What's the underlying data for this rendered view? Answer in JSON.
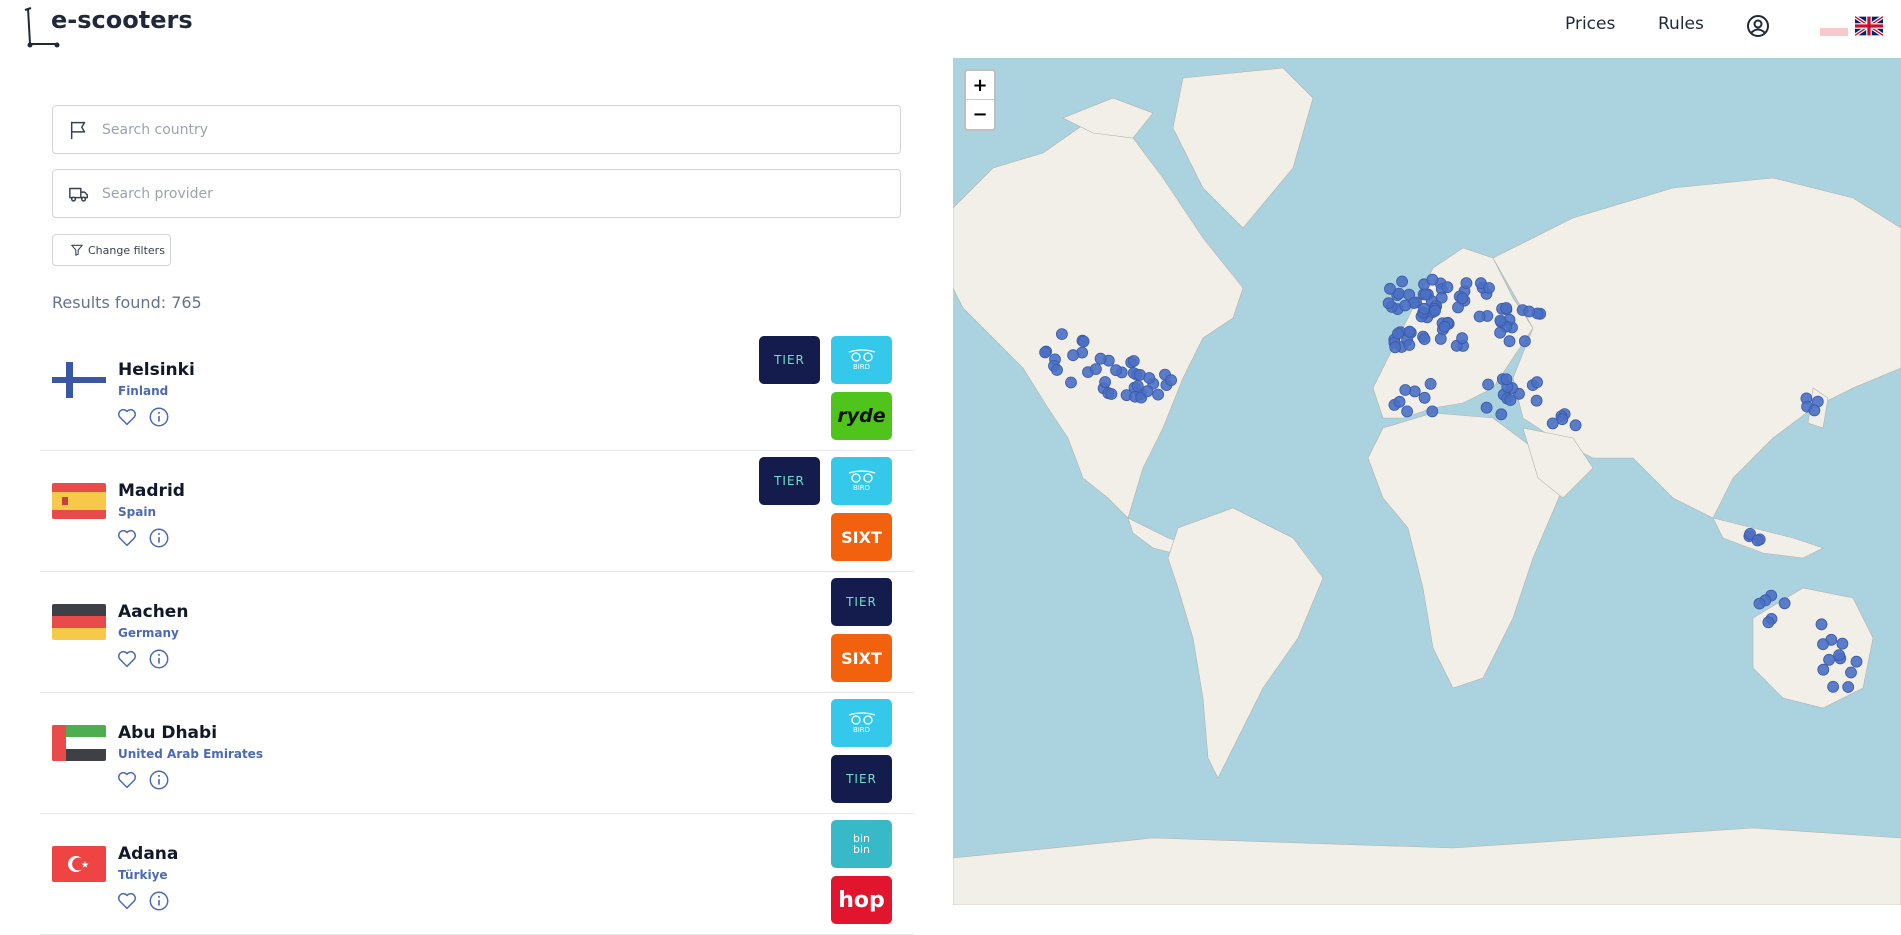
{
  "header": {
    "logo_text": "e-scooters",
    "nav": {
      "prices": "Prices",
      "rules": "Rules"
    }
  },
  "search": {
    "country_placeholder": "Search country",
    "provider_placeholder": "Search provider"
  },
  "filters": {
    "label": "Change filters"
  },
  "results": {
    "text": "Results found: 765"
  },
  "cities": [
    {
      "city": "Helsinki",
      "country": "Finland",
      "providers": [
        "TIER",
        "BIRD",
        "ryde"
      ]
    },
    {
      "city": "Madrid",
      "country": "Spain",
      "providers": [
        "TIER",
        "BIRD",
        "SIXT"
      ]
    },
    {
      "city": "Aachen",
      "country": "Germany",
      "providers": [
        "TIER",
        "SIXT"
      ]
    },
    {
      "city": "Abu Dhabi",
      "country": "United Arab Emirates",
      "providers": [
        "BIRD",
        "TIER"
      ]
    },
    {
      "city": "Adana",
      "country": "Türkiye",
      "providers": [
        "bin bin",
        "hop"
      ]
    }
  ],
  "provider_labels": {
    "tier": "TIER",
    "bird": "BIRD",
    "ryde": "ryde",
    "sixt": "SIXT",
    "binbin_1": "bin",
    "binbin_2": "bin",
    "hop": "hop"
  },
  "map": {
    "zoom_in": "+",
    "zoom_out": "−"
  },
  "colors": {
    "marker": "#4a6fc4",
    "water": "#aad3df",
    "land": "#f2efe9",
    "tier_bg": "#131c4c",
    "bird_bg": "#34c8ea",
    "ryde_bg": "#4fc41a",
    "sixt_bg": "#f1610e",
    "binbin_bg": "#38b9c8",
    "hop_bg": "#e2152f"
  }
}
